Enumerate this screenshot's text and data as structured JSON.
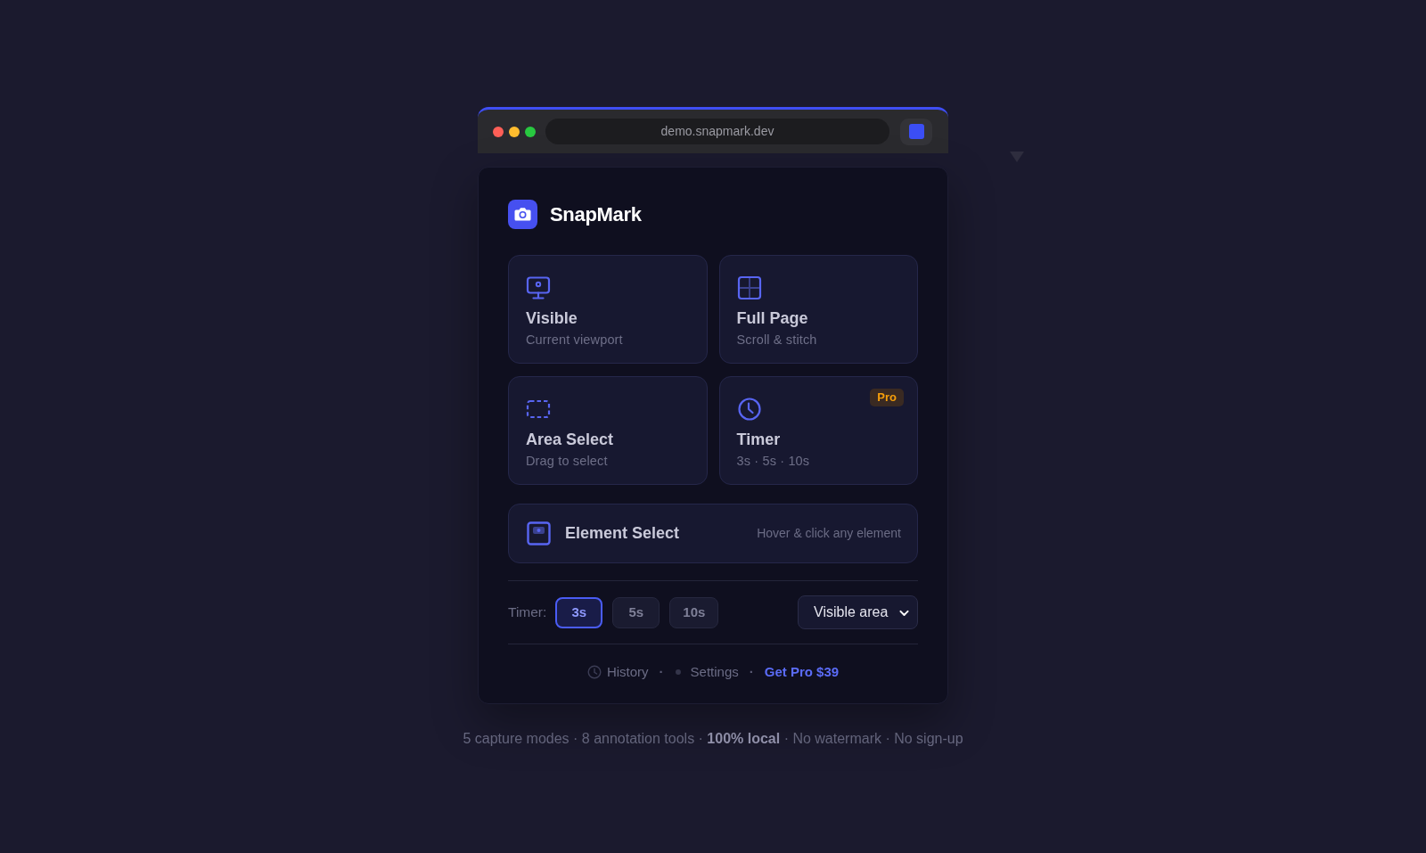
{
  "browser": {
    "address": "demo.snapmark.dev"
  },
  "popup": {
    "app_name": "SnapMark",
    "mode_rows": [
      [
        {
          "title": "Visible",
          "subtitle": "Current viewport"
        },
        {
          "title": "Full Page",
          "subtitle": "Scroll & stitch"
        }
      ],
      [
        {
          "title": "Area Select",
          "subtitle": "Drag to select"
        },
        {
          "badge": "Pro",
          "title": "Timer",
          "subtitle": "3s · 5s · 10s"
        }
      ]
    ],
    "element_select": {
      "title": "Element Select",
      "hint": "Hover & click any element"
    },
    "timer": {
      "label": "Timer:",
      "options": [
        {
          "label": "3s",
          "selected": true
        },
        {
          "label": "5s",
          "selected": false
        },
        {
          "label": "10s",
          "selected": false
        }
      ]
    },
    "capture_area": {
      "value": "Visible area"
    },
    "footer_links": [
      {
        "label": "History",
        "highlighted": false,
        "separator": "·"
      },
      {
        "label": "Settings",
        "highlighted": false,
        "separator": "·"
      },
      {
        "label": "Get Pro $39",
        "highlighted": true
      }
    ]
  },
  "caption": "5 capture modes · 8 annotation tools · **100% local** · No watermark · No sign-up"
}
